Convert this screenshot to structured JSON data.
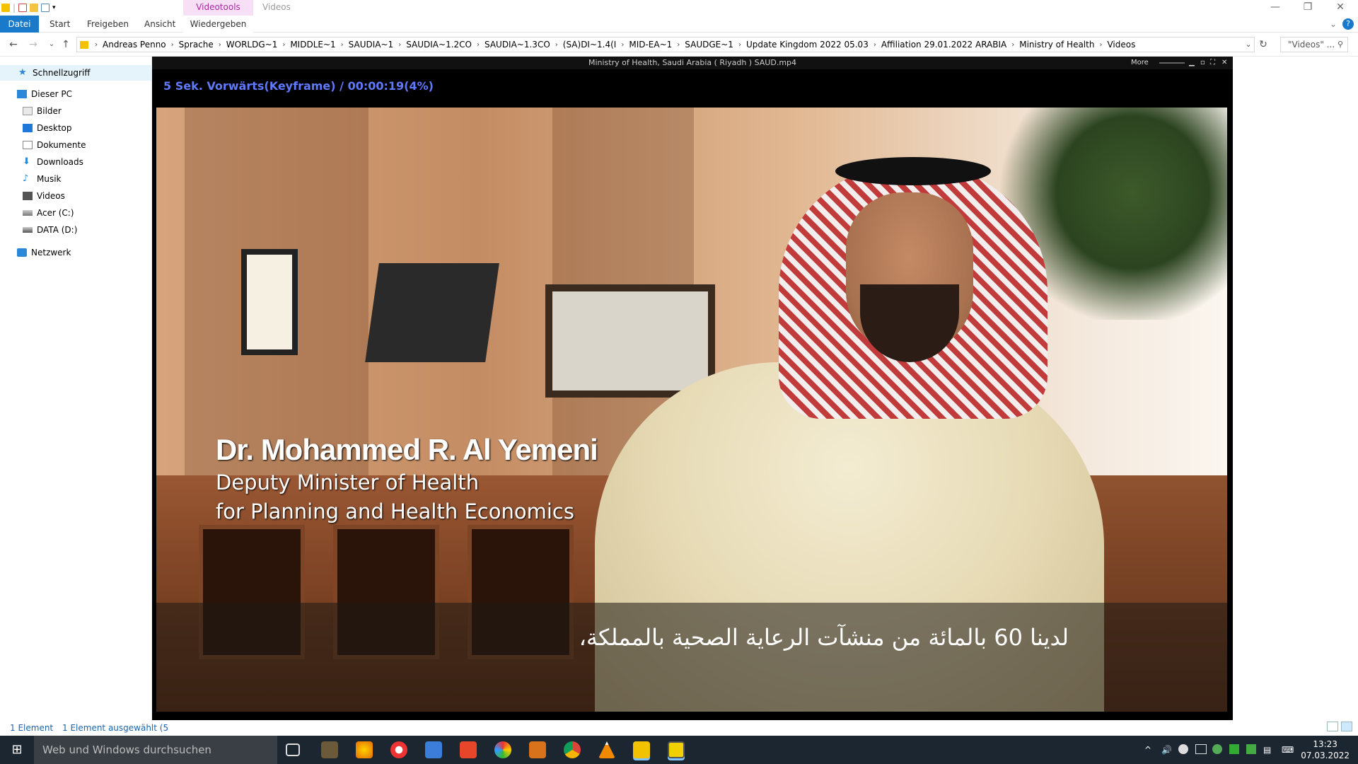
{
  "window": {
    "contextual_tab": "Videotools",
    "title": "Videos",
    "controls": {
      "minimize": "—",
      "maximize": "❐",
      "close": "✕"
    }
  },
  "ribbon": {
    "file": "Datei",
    "tabs": [
      "Start",
      "Freigeben",
      "Ansicht"
    ],
    "context_tab": "Wiedergeben"
  },
  "address": {
    "crumbs": [
      "Andreas Penno",
      "Sprache",
      "WORLDG~1",
      "MIDDLE~1",
      "SAUDIA~1",
      "SAUDIA~1.2CO",
      "SAUDIA~1.3CO",
      "(SA)DI~1.4(I",
      "MID-EA~1",
      "SAUDGE~1",
      "Update Kingdom 2022 05.03",
      "Affiliation 29.01.2022 ARABIA",
      "Ministry of Health",
      "Videos"
    ],
    "search_placeholder": "\"Videos\" ..."
  },
  "sidebar": {
    "quick_access": "Schnellzugriff",
    "this_pc": "Dieser PC",
    "items": [
      "Bilder",
      "Desktop",
      "Dokumente",
      "Downloads",
      "Musik",
      "Videos",
      "Acer (C:)",
      "DATA (D:)"
    ],
    "network": "Netzwerk"
  },
  "status": {
    "count": "1 Element",
    "selected": "1 Element ausgewählt (5"
  },
  "player": {
    "title": "Ministry of Health, Saudi Arabia ( Riyadh ) SAUD.mp4",
    "more": "More",
    "osd": "5  Sek. Vorwärts(Keyframe) / 00:00:19(4%)",
    "progress_percent": 4,
    "overlay_name": "Dr. Mohammed R. Al Yemeni",
    "overlay_role_1": "Deputy Minister of Health",
    "overlay_role_2": "for Planning and Health Economics",
    "subtitle": "لدينا 60 بالمائة من منشآت الرعاية الصحية بالمملكة،"
  },
  "taskbar": {
    "start": "⊞",
    "search_placeholder": "Web und Windows durchsuchen",
    "time": "13:23",
    "date": "07.03.2022"
  }
}
